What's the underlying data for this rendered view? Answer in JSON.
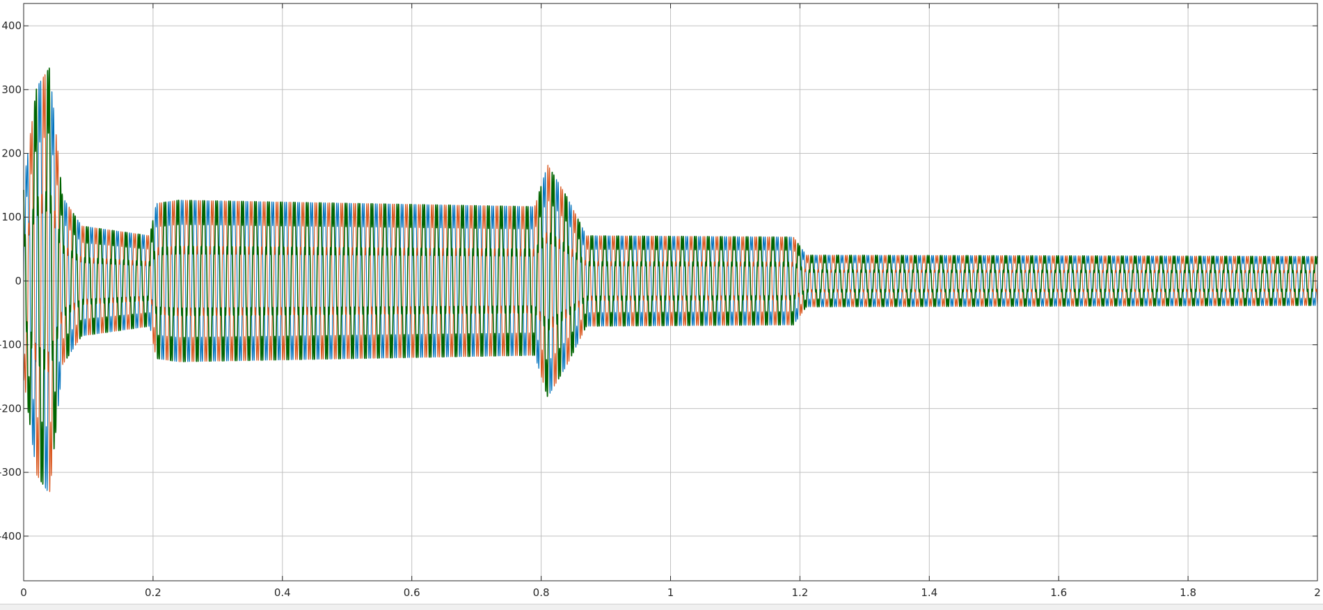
{
  "chart_data": {
    "type": "line",
    "title": "",
    "xlabel": "",
    "ylabel": "",
    "xlim": [
      0,
      2
    ],
    "ylim": [
      -470,
      435
    ],
    "x_ticks": [
      0,
      0.2,
      0.4,
      0.6,
      0.8,
      1,
      1.2,
      1.4,
      1.6,
      1.8,
      2
    ],
    "x_tick_labels": [
      "0",
      "0.2",
      "0.4",
      "0.6",
      "0.8",
      "1",
      "1.2",
      "1.4",
      "1.6",
      "1.8",
      "2"
    ],
    "y_ticks": [
      400,
      300,
      200,
      100,
      0,
      -100,
      -200,
      -300,
      -400
    ],
    "y_tick_labels": [
      "400",
      "300",
      "200",
      "100",
      "0",
      "-100",
      "-200",
      "-300",
      "-400"
    ],
    "grid": true,
    "legend": "none",
    "frequency_hz": 50,
    "harmonic_ratio": 0.22,
    "harmonic_order": 7,
    "amplitude_envelope": [
      {
        "x": 0.0,
        "amplitude": 150
      },
      {
        "x": 0.02,
        "amplitude": 300
      },
      {
        "x": 0.04,
        "amplitude": 330
      },
      {
        "x": 0.06,
        "amplitude": 130
      },
      {
        "x": 0.09,
        "amplitude": 85
      },
      {
        "x": 0.195,
        "amplitude": 70
      },
      {
        "x": 0.205,
        "amplitude": 120
      },
      {
        "x": 0.24,
        "amplitude": 125
      },
      {
        "x": 0.79,
        "amplitude": 115
      },
      {
        "x": 0.81,
        "amplitude": 180
      },
      {
        "x": 0.84,
        "amplitude": 130
      },
      {
        "x": 0.87,
        "amplitude": 70
      },
      {
        "x": 1.19,
        "amplitude": 68
      },
      {
        "x": 1.21,
        "amplitude": 40
      },
      {
        "x": 2.0,
        "amplitude": 38
      }
    ],
    "series": [
      {
        "color": "#0072BD",
        "phase_deg": 0
      },
      {
        "color": "#D95319",
        "phase_deg": -120
      },
      {
        "color": "#006400",
        "phase_deg": 120
      }
    ]
  }
}
